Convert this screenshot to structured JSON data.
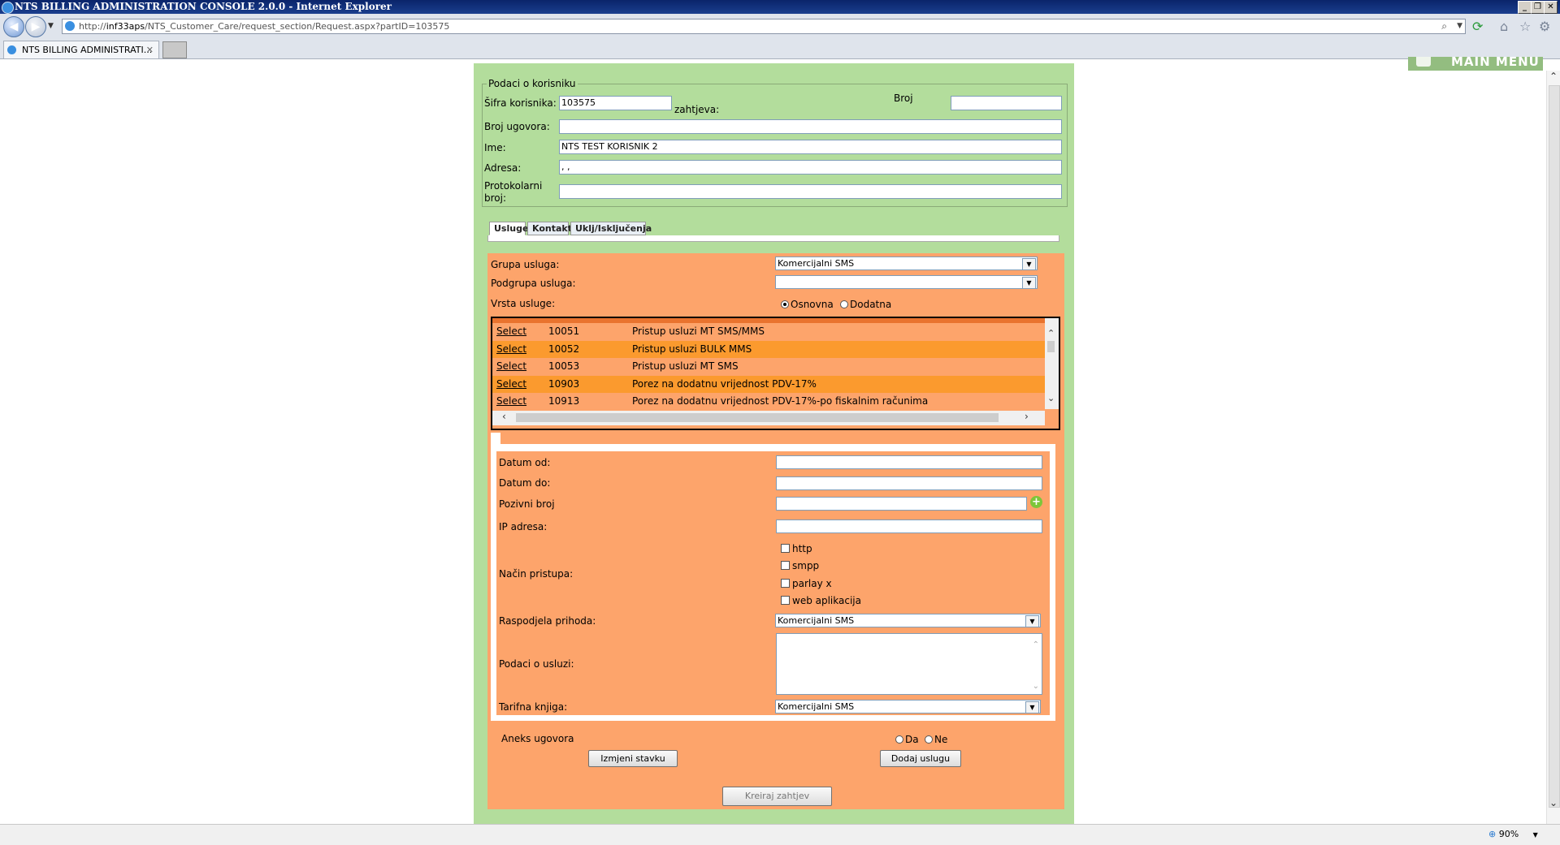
{
  "window": {
    "title": "NTS BILLING ADMINISTRATION CONSOLE 2.0.0 - Internet Explorer"
  },
  "browser": {
    "url_prefix": "http://",
    "url_host": "inf33aps",
    "url_path": "/NTS_Customer_Care/request_section/Request.aspx?partID=103575",
    "tab_label": "NTS BILLING ADMINISTRATI...",
    "zoom": "90%"
  },
  "header": {
    "main_menu": "MAIN MENU"
  },
  "korisnik": {
    "legend": "Podaci o korisniku",
    "sifra_label": "Šifra korisnika:",
    "sifra_value": "103575",
    "zahtjeva_label": "zahtjeva:",
    "broj_label": "Broj",
    "broj_value": "",
    "ugovor_label": "Broj ugovora:",
    "ugovor_value": "",
    "ime_label": "Ime:",
    "ime_value": "NTS TEST KORISNIK 2",
    "adresa_label": "Adresa:",
    "adresa_value": ",  ,",
    "protokol_label_1": "Protokolarni",
    "protokol_label_2": "broj:",
    "protokol_value": ""
  },
  "tabs": [
    "Usluge",
    "Kontakt",
    "Uklj/Isključenja"
  ],
  "usluge": {
    "grupa_label": "Grupa usluga:",
    "grupa_value": "Komercijalni SMS",
    "podgrupa_label": "Podgrupa usluga:",
    "podgrupa_value": "",
    "vrsta_label": "Vrsta usluge:",
    "vrsta_osnovna": "Osnovna",
    "vrsta_dodatna": "Dodatna",
    "vrsta_selected": "Osnovna"
  },
  "grid": {
    "select_label": "Select",
    "rows": [
      {
        "code": "10051",
        "desc": "Pristup usluzi MT SMS/MMS"
      },
      {
        "code": "10052",
        "desc": "Pristup usluzi BULK MMS"
      },
      {
        "code": "10053",
        "desc": "Pristup usluzi MT SMS"
      },
      {
        "code": "10903",
        "desc": "Porez na dodatnu vrijednost PDV-17%"
      },
      {
        "code": "10913",
        "desc": "Porez na dodatnu vrijednost PDV-17%-po fiskalnim računima"
      }
    ],
    "row_colors": [
      "#fda46b",
      "#fb9a2e"
    ]
  },
  "detalji": {
    "datum_od_label": "Datum od:",
    "datum_do_label": "Datum do:",
    "pozivni_label": "Pozivni broj",
    "ip_label": "IP adresa:",
    "nacin_label": "Način pristupa:",
    "nacin_opcije": [
      "http",
      "smpp",
      "parlay x",
      "web aplikacija"
    ],
    "raspodjela_label": "Raspodjela prihoda:",
    "raspodjela_value": "Komercijalni SMS",
    "podaci_label": "Podaci o usluzi:",
    "tarifna_label": "Tarifna knjiga:",
    "tarifna_value": "Komercijalni SMS"
  },
  "aneks": {
    "label": "Aneks ugovora",
    "da": "Da",
    "ne": "Ne"
  },
  "buttons": {
    "izmjeni": "Izmjeni stavku",
    "dodaj": "Dodaj uslugu",
    "kreiraj": "Kreiraj zahtjev"
  },
  "colors": {
    "green_bg": "#b3dd9c",
    "orange_bg": "#fda46b",
    "title_bar": "#0a246a"
  }
}
